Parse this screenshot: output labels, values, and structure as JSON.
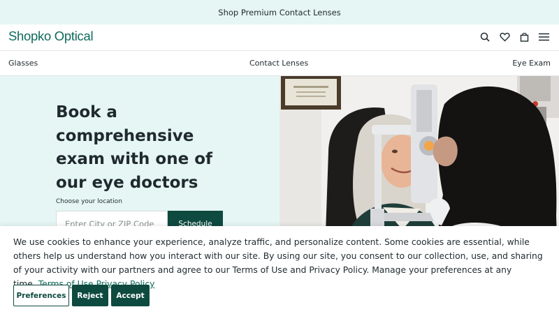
{
  "promo": {
    "text": "Shop Premium Contact Lenses"
  },
  "header": {
    "logo": "Shopko Optical",
    "icons": [
      "search-icon",
      "heart-icon",
      "bag-icon",
      "menu-icon"
    ]
  },
  "nav": {
    "items": [
      {
        "label": "Glasses"
      },
      {
        "label": "Contact Lenses"
      },
      {
        "label": "Eye Exam"
      }
    ]
  },
  "hero": {
    "title": "Book a comprehensive exam with one of our eye doctors",
    "location_label": "Choose your location",
    "location_placeholder": "Enter City or ZIP Code",
    "schedule_label": "Schedule"
  },
  "cookie": {
    "text": "We use cookies to enhance your experience, analyze traffic, and personalize content. Some cookies are essential, while others help us understand how you interact with our site. By using our site, you consent to our collection, use, and sharing of your activity with our partners and agree to our Terms of Use and Privacy Policy. Manage your preferences at any time.",
    "terms_link": "Terms of Use",
    "privacy_link": "Privacy Policy",
    "preferences_label": "Preferences",
    "reject_label": "Reject",
    "accept_label": "Accept"
  },
  "colors": {
    "brand": "#0e6a5c",
    "dark_green": "#0e4a3f",
    "mint_bg": "#e6f6f5"
  }
}
